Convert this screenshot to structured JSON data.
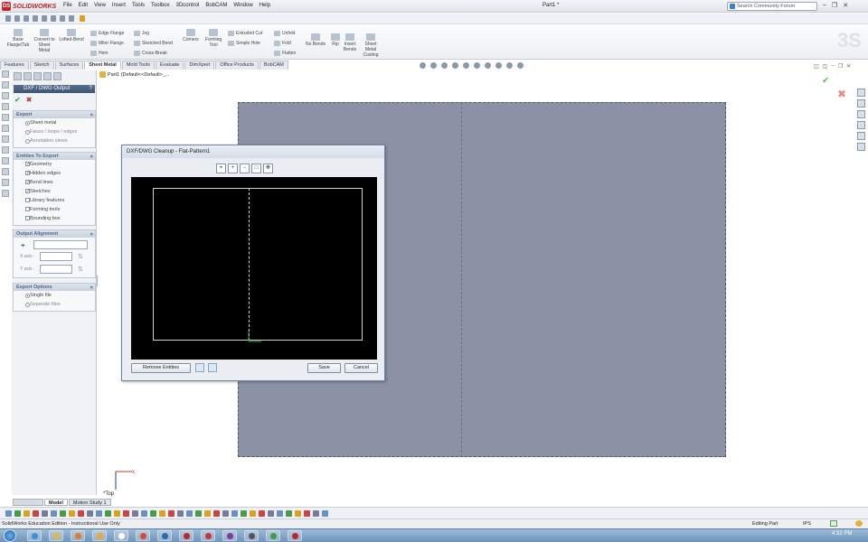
{
  "app": {
    "name": "SOLIDWORKS",
    "document_title": "Part1 *"
  },
  "menus": [
    "File",
    "Edit",
    "View",
    "Insert",
    "Tools",
    "Toolbox",
    "3Dcontrol",
    "BobCAM",
    "Window",
    "Help"
  ],
  "search": {
    "placeholder": "Search Community Forum"
  },
  "ribbon": {
    "big": [
      {
        "label": "Base Flange/Tab"
      },
      {
        "label": "Convert to Sheet Metal"
      },
      {
        "label": "Lofted-Bend"
      },
      {
        "label": "Corners"
      },
      {
        "label": "Forming Tool"
      },
      {
        "label": "No Bends"
      },
      {
        "label": "Rip"
      },
      {
        "label": "Insert Bends"
      },
      {
        "label": "Sheet Metal Costing"
      }
    ],
    "small": [
      {
        "label": "Edge Flange"
      },
      {
        "label": "Miter Flange"
      },
      {
        "label": "Hem"
      },
      {
        "label": "Jog"
      },
      {
        "label": "Sketched Bend"
      },
      {
        "label": "Cross-Break"
      },
      {
        "label": "Extruded Cut"
      },
      {
        "label": "Simple Hole"
      },
      {
        "label": "Unfold"
      },
      {
        "label": "Fold"
      },
      {
        "label": "Flatten"
      }
    ]
  },
  "tabs": [
    "Features",
    "Sketch",
    "Surfaces",
    "Sheet Metal",
    "Mold Tools",
    "Evaluate",
    "DimXpert",
    "Office Products",
    "BobCAM"
  ],
  "tree_path": "Part1  (Default<<Default>_...",
  "panel": {
    "title": "DXF / DWG Output",
    "help": "?",
    "ok": "✔",
    "cancel": "✖",
    "export": {
      "header": "Export",
      "options": [
        "Sheet metal",
        "Faces / loops / edges",
        "Annotation views"
      ]
    },
    "entities": {
      "header": "Entities To Export",
      "items": [
        {
          "label": "Geometry",
          "checked": true
        },
        {
          "label": "Hidden edges",
          "checked": true
        },
        {
          "label": "Bend lines",
          "checked": true
        },
        {
          "label": "Sketches",
          "checked": true
        },
        {
          "label": "Library features",
          "checked": false
        },
        {
          "label": "Forming tools",
          "checked": false
        },
        {
          "label": "Bounding box",
          "checked": false
        }
      ]
    },
    "alignment": {
      "header": "Output Alignment",
      "x_label": "X axis :",
      "y_label": "Y axis :"
    },
    "export_options": {
      "header": "Export Options",
      "options": [
        "Single file",
        "Separate files"
      ]
    }
  },
  "dialog": {
    "title": "DXF/DWG Cleanup - Flat-Pattern1",
    "remove_btn": "Remove Entities",
    "save_btn": "Save",
    "cancel_btn": "Cancel"
  },
  "view_label": "*Top",
  "bottom_tabs": [
    "Model",
    "Motion Study 1"
  ],
  "status": {
    "left": "SolidWorks Education Edition - Instructional Use Only",
    "mode": "Editing Part",
    "units": "IPS"
  },
  "clock": "4:32 PM",
  "colors": {
    "sheet": "#8c92a6",
    "accent": "#c0242a",
    "title_blue": "#3e5675"
  }
}
